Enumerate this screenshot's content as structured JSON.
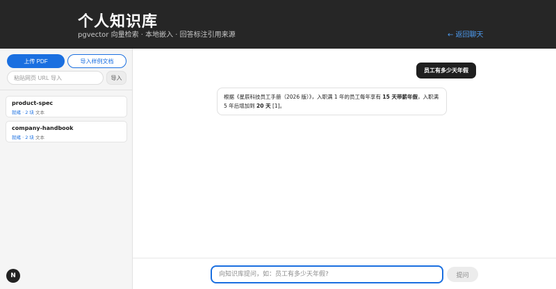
{
  "header": {
    "title": "个人知识库",
    "subtitle": "pgvector 向量检索 · 本地嵌入 · 回答标注引用来源",
    "back_label": "← 返回聊天"
  },
  "sidebar": {
    "upload_label": "上传 PDF",
    "import_sample_label": "导入样例文档",
    "url_placeholder": "粘贴网页 URL 导入",
    "url_value": "",
    "url_import_label": "导入",
    "documents": [
      {
        "name": "product-spec",
        "status": "就绪",
        "chunks": "· 2 块",
        "type": "文本"
      },
      {
        "name": "company-handbook",
        "status": "就绪",
        "chunks": "· 2 块",
        "type": "文本"
      }
    ]
  },
  "fab": {
    "label": "N"
  },
  "chat": {
    "messages": [
      {
        "role": "user",
        "text": "员工有多少天年假"
      },
      {
        "role": "assistant",
        "parts": {
          "p1": "根据《星辰科技员工手册（2026 版）》，入职满 1 年的员工每年享有 ",
          "b1": "15 天带薪年假",
          "p2": "，入职满 5 年后增加到 ",
          "b2": "20 天",
          "p3": " [1]。"
        }
      }
    ]
  },
  "composer": {
    "placeholder": "向知识库提问，如：员工有多少天年假?",
    "value": "",
    "send_label": "提问"
  },
  "colors": {
    "header_bg": "#262626",
    "accent": "#1a6fe0",
    "sidebar_bg": "#f5f5f5",
    "user_bubble": "#1f1f1f"
  }
}
